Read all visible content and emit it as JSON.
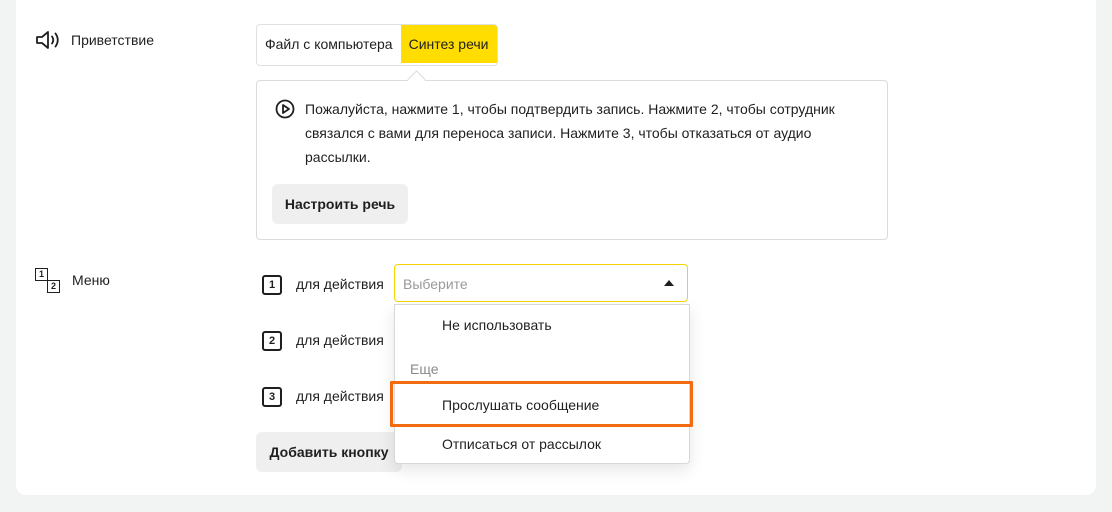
{
  "greeting": {
    "label": "Приветствие",
    "tabs": [
      {
        "label": "Файл с компьютера",
        "active": false
      },
      {
        "label": "Синтез речи",
        "active": true
      }
    ],
    "tts_text": "Пожалуйста, нажмите 1, чтобы подтвердить запись. Нажмите 2, чтобы сотрудник связался с вами для переноса записи. Нажмите 3, чтобы отказаться от аудио рассылки.",
    "configure_button": "Настроить речь"
  },
  "menu": {
    "label": "Меню",
    "icon_digits": [
      "1",
      "2"
    ],
    "rows": [
      {
        "number": "1",
        "label": "для действия"
      },
      {
        "number": "2",
        "label": "для действия"
      },
      {
        "number": "3",
        "label": "для действия"
      }
    ],
    "select_placeholder": "Выберите",
    "add_button": "Добавить кнопку"
  },
  "dropdown": {
    "option_none": "Не использовать",
    "group_label": "Еще",
    "option_listen": "Прослушать сообщение",
    "option_unsubscribe": "Отписаться от рассылок"
  },
  "colors": {
    "accent": "#ffdd00",
    "highlight": "#f26b10"
  }
}
